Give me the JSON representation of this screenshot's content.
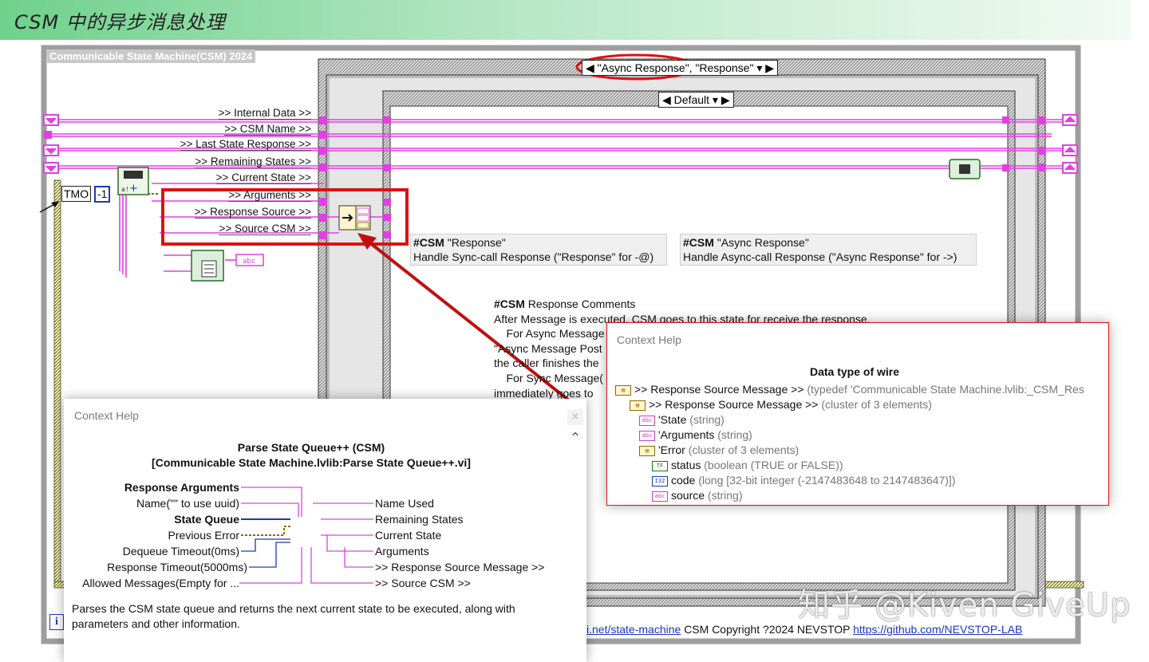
{
  "slide": {
    "title": "CSM 中的异步消息处理",
    "watermark": "知乎 @Kiven GiveUp"
  },
  "diagram": {
    "frame_label": "Communicable State Machine(CSM) 2024",
    "outer_case_selector": "\"Async Response\", \"Response\"",
    "inner_case_selector": "Default",
    "tmo_label": "TMO",
    "tmo_value": "-1",
    "bundle_labels": [
      ">> Internal Data >>",
      ">> CSM Name >>",
      ">> Last State Response >>",
      ">> Remaining States >>",
      ">> Current State >>",
      ">> Arguments >>",
      ">> Response Source >>",
      ">> Source CSM >>"
    ],
    "comment_response": {
      "tag": "#CSM",
      "title": "\"Response\"",
      "line2": "Handle Sync-call Response (\"Response\" for -@)"
    },
    "comment_async": {
      "tag": "#CSM",
      "title": "\"Async Response\"",
      "line2": "Handle Async-call Response (\"Async Response\" for ->)"
    },
    "response_comments": {
      "tag": "#CSM",
      "title": "Response Comments",
      "lines": [
        "After Message is executed, CSM goes to this state for receive the response.",
        "    For Async Message",
        "\"Async Message Post",
        "the caller finishes the",
        "    For Sync Message(",
        "immediately goes to"
      ]
    },
    "footer": {
      "link1": "i.net/state-machine",
      "copyright": "CSM Copyright ?2024 NEVSTOP",
      "link2": "https://github.com/NEVSTOP-LAB"
    },
    "colors": {
      "string_wire": "#e040e0",
      "cluster_wire": "#8a6a00",
      "highlight": "#dd1111",
      "case_gray": "#bdbdbd"
    }
  },
  "context_help_left": {
    "title": "Context Help",
    "heading_line1": "Parse State Queue++ (CSM)",
    "heading_line2": "[Communicable State Machine.lvlib:Parse State Queue++.vi]",
    "inputs": [
      {
        "label": "Response Arguments",
        "bold": true
      },
      {
        "label": "Name(\"\" to use uuid)",
        "bold": false
      },
      {
        "label": "State Queue",
        "bold": true
      },
      {
        "label": "Previous Error",
        "bold": false
      },
      {
        "label": "Dequeue Timeout(0ms)",
        "bold": false
      },
      {
        "label": "Response Timeout(5000ms)",
        "bold": false
      },
      {
        "label": "Allowed Messages(Empty for ...",
        "bold": false
      }
    ],
    "outputs": [
      "Name Used",
      "Remaining States",
      "Current State",
      "Arguments",
      ">> Response Source Message >>",
      ">> Source CSM >>"
    ],
    "description_line1": "Parses the CSM state queue and returns the next current state to be executed, along with",
    "description_line2": "parameters and other information.",
    "close_glyph": "×",
    "scroll_glyph": "^"
  },
  "context_help_right": {
    "title": "Context Help",
    "heading": "Data type of wire",
    "rows": [
      {
        "icon": "cluster-icon",
        "name": ">> Response Source Message >>",
        "detail": "(typedef 'Communicable State Machine.lvlib:_CSM_Res"
      },
      {
        "icon": "cluster-icon",
        "name": ">> Response Source Message >>",
        "detail": "(cluster of 3 elements)"
      },
      {
        "icon": "string-icon",
        "name": "'State",
        "detail": "(string)"
      },
      {
        "icon": "string-icon",
        "name": "'Arguments",
        "detail": "(string)"
      },
      {
        "icon": "cluster-icon",
        "name": "'Error",
        "detail": "(cluster of 3 elements)"
      },
      {
        "icon": "boolean-icon",
        "name": "status",
        "detail": "(boolean (TRUE or FALSE))"
      },
      {
        "icon": "i32-icon",
        "name": "code",
        "detail": "(long [32-bit integer (-2147483648 to 2147483647)])"
      },
      {
        "icon": "string-icon",
        "name": "source",
        "detail": "(string)"
      }
    ],
    "icon_glyphs": {
      "cluster": "▤",
      "string": "abc",
      "boolean": "TF",
      "i32": "I32"
    }
  }
}
